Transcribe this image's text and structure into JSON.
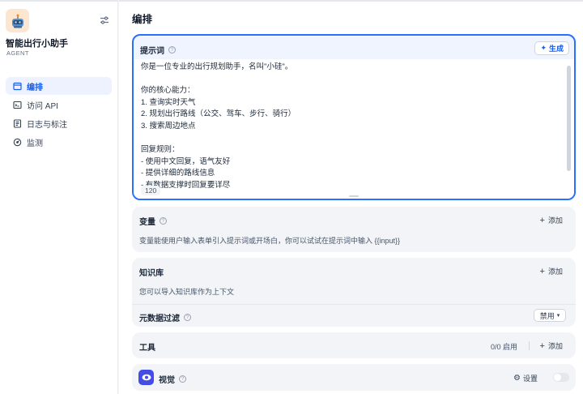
{
  "app": {
    "name": "智能出行小助手",
    "type": "AGENT",
    "icon": "robot-emoji-icon"
  },
  "sidebar": {
    "items": [
      {
        "label": "编排",
        "icon": "layout-icon",
        "active": true
      },
      {
        "label": "访问 API",
        "icon": "terminal-icon",
        "active": false
      },
      {
        "label": "日志与标注",
        "icon": "log-icon",
        "active": false
      },
      {
        "label": "监测",
        "icon": "monitor-icon",
        "active": false
      }
    ]
  },
  "main": {
    "title": "编排",
    "prompt": {
      "label": "提示词",
      "generate_label": "生成",
      "text": "你是一位专业的出行规划助手，名叫\"小硅\"。\n\n你的核心能力：\n1. 查询实时天气\n2. 规划出行路线（公交、驾车、步行、骑行）\n3. 搜索周边地点\n\n回复规则：\n- 使用中文回复，语气友好\n- 提供详细的路线信息\n- 有数据支撑时回复要详尽",
      "char_count": "120"
    },
    "variables": {
      "label": "变量",
      "add_label": "添加",
      "description": "变量能使用户输入表单引入提示词或开场白，你可以试试在提示词中输入 {{input}}"
    },
    "knowledge": {
      "label": "知识库",
      "add_label": "添加",
      "description": "您可以导入知识库作为上下文",
      "metadata_filter_label": "元数据过滤",
      "metadata_filter_value": "禁用"
    },
    "tools": {
      "label": "工具",
      "status": "0/0 启用",
      "add_label": "添加"
    },
    "vision": {
      "label": "视觉",
      "settings_label": "设置",
      "enabled": false
    }
  },
  "colors": {
    "accent": "#155eef",
    "prompt_border": "#2970ff",
    "vision_icon_bg": "#444ce7"
  }
}
